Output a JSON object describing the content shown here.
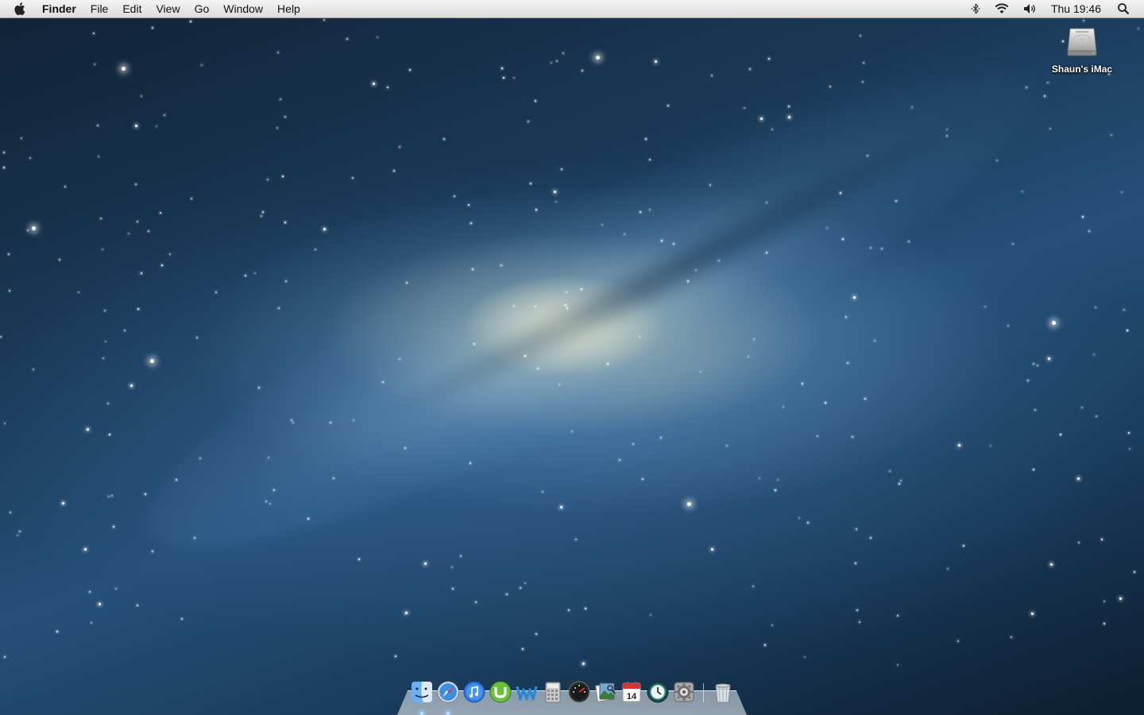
{
  "menubar": {
    "apple_icon": "apple-icon",
    "app_name": "Finder",
    "menus": [
      "File",
      "Edit",
      "View",
      "Go",
      "Window",
      "Help"
    ],
    "status_icons": [
      "bluetooth-icon",
      "wifi-icon",
      "volume-icon"
    ],
    "clock": "Thu 19:46",
    "spotlight_icon": "spotlight-search-icon"
  },
  "desktop": {
    "wallpaper": "galaxy",
    "icons": [
      {
        "label": "Shaun's iMac",
        "icon": "hard-drive-icon"
      }
    ]
  },
  "dock": {
    "items": [
      {
        "icon": "finder-icon",
        "running": true
      },
      {
        "icon": "safari-icon",
        "running": true
      },
      {
        "icon": "itunes-icon",
        "running": false
      },
      {
        "icon": "utorrent-icon",
        "running": false
      },
      {
        "icon": "wunderlist-icon",
        "running": false
      },
      {
        "icon": "calculator-icon",
        "running": false
      },
      {
        "icon": "dashboard-icon",
        "running": false
      },
      {
        "icon": "preview-icon",
        "running": false
      },
      {
        "icon": "calendar-icon",
        "running": false,
        "badge": "14"
      },
      {
        "icon": "time-machine-icon",
        "running": false
      },
      {
        "icon": "system-preferences-icon",
        "running": false
      },
      {
        "icon": "trash-icon",
        "running": false
      }
    ]
  },
  "colors": {
    "menubar_bg": "#e8e8e8",
    "sky_dark": "#0f2236",
    "galaxy_core": "#fff4c8",
    "accent_blue": "#2a6fbd"
  }
}
